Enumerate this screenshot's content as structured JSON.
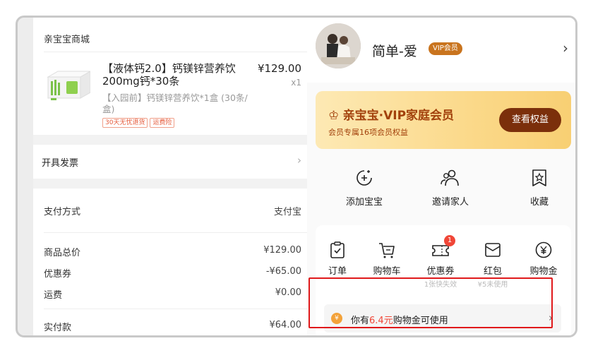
{
  "order": {
    "shop_name": "亲宝宝商城",
    "product": {
      "title": "【液体钙2.0】钙镁锌营养饮200mg钙*30条",
      "price": "¥129.00",
      "qty": "x1",
      "subtitle": "【入园前】钙镁锌营养饮*1盒 (30条/盒)",
      "tags": [
        "30天无忧退货",
        "运费险"
      ]
    },
    "invoice_label": "开具发票",
    "payment": {
      "method_label": "支付方式",
      "method_value": "支付宝",
      "total_label": "商品总价",
      "total_value": "¥129.00",
      "coupon_label": "优惠券",
      "coupon_value": "-¥65.00",
      "shipping_label": "运费",
      "shipping_value": "¥0.00",
      "paid_label": "实付款",
      "paid_value": "¥64.00"
    }
  },
  "profile": {
    "username": "简单-爱",
    "vip_badge": "VIP会员",
    "vip_card": {
      "title": "亲宝宝·VIP家庭会员",
      "subtitle": "会员专属16项会员权益",
      "button": "查看权益"
    },
    "quick_actions": [
      "添加宝宝",
      "邀请家人",
      "收藏"
    ],
    "order_items": [
      {
        "label": "订单",
        "sub": ""
      },
      {
        "label": "购物车",
        "sub": ""
      },
      {
        "label": "优惠券",
        "sub": "1张快失效",
        "badge": "1"
      },
      {
        "label": "红包",
        "sub": "¥5未使用"
      },
      {
        "label": "购物金",
        "sub": ""
      }
    ],
    "coin_bar": {
      "icon": "¥",
      "prefix": "你有",
      "amount": "6.4元",
      "suffix": "购物金可使用"
    }
  },
  "colors": {
    "accent_red": "#f04637",
    "vip_brown": "#7b2f0b",
    "highlight_box": "#e0191b"
  }
}
